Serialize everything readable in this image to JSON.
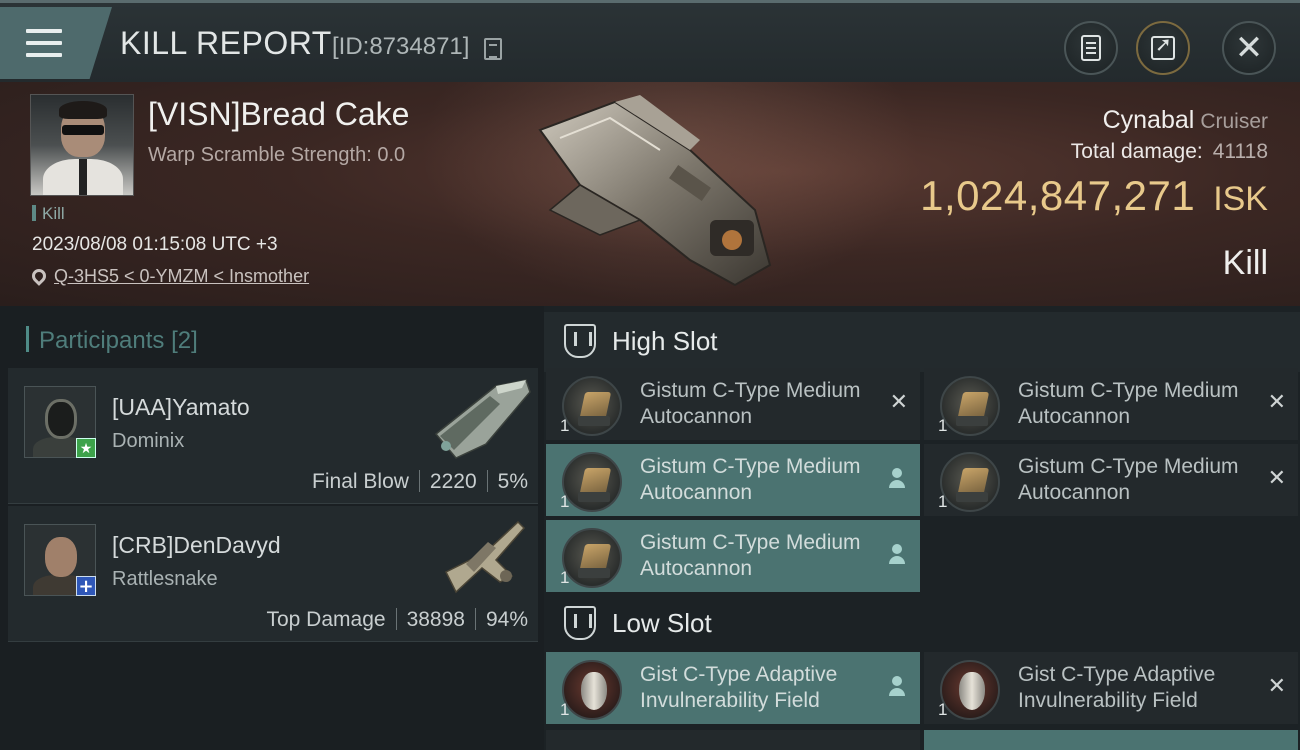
{
  "header": {
    "title": "KILL REPORT",
    "report_id": "[ID:8734871]"
  },
  "victim": {
    "name": "[VISN]Bread Cake",
    "subtitle": "Warp Scramble Strength: 0.0",
    "kill_tag": "Kill",
    "datetime": "2023/08/08 01:15:08 UTC +3",
    "location": "Q-3HS5 < 0-YMZM < Insmother",
    "ship_name": "Cynabal",
    "ship_class": "Cruiser",
    "damage_label": "Total damage:",
    "damage_value": "41118",
    "isk_value": "1,024,847,271",
    "isk_unit": "ISK",
    "result": "Kill"
  },
  "participants": {
    "label": "Participants",
    "count": "[2]",
    "items": [
      {
        "name": "[UAA]Yamato",
        "ship": "Dominix",
        "stat_label": "Final Blow",
        "damage": "2220",
        "percent": "5%",
        "badge": "star-icon"
      },
      {
        "name": "[CRB]DenDavyd",
        "ship": "Rattlesnake",
        "stat_label": "Top Damage",
        "damage": "38898",
        "percent": "94%",
        "badge": "plus-icon"
      }
    ]
  },
  "fitting": {
    "high_slot_label": "High Slot",
    "low_slot_label": "Low Slot",
    "high_modules": [
      {
        "name": "Gistum C-Type Medium Autocannon",
        "qty": "1",
        "state": "destroyed"
      },
      {
        "name": "Gistum C-Type Medium Autocannon",
        "qty": "1",
        "state": "destroyed"
      },
      {
        "name": "Gistum C-Type Medium Autocannon",
        "qty": "1",
        "state": "dropped"
      },
      {
        "name": "Gistum C-Type Medium Autocannon",
        "qty": "1",
        "state": "destroyed"
      },
      {
        "name": "Gistum C-Type Medium Autocannon",
        "qty": "1",
        "state": "dropped"
      }
    ],
    "low_modules": [
      {
        "name": "Gist C-Type Adaptive Invulnerability Field",
        "qty": "1",
        "state": "dropped"
      },
      {
        "name": "Gist C-Type Adaptive Invulnerability Field",
        "qty": "1",
        "state": "destroyed"
      }
    ]
  },
  "colors": {
    "accent_teal": "#4b7371",
    "isk_gold": "#e8c98b",
    "badge_green": "#3da24a",
    "badge_blue": "#2f57b8"
  }
}
